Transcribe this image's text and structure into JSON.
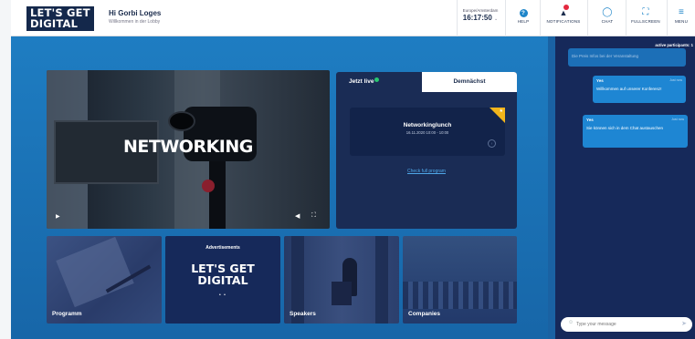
{
  "header": {
    "logo_line1": "LET'S GET",
    "logo_line2": "DIGITAL",
    "greeting_name": "Hi Gorbi Loges",
    "greeting_sub": "Willkommen in der Lobby",
    "timezone": "Europe/Amsterdam",
    "time": "16:17:50",
    "tools": {
      "help": "HELP",
      "notifications": "NOTIFICATIONS",
      "chat": "CHAT",
      "fullscreen": "FULLSCREEN",
      "menu": "MENU"
    }
  },
  "hero": {
    "title": "NETWORKING"
  },
  "schedule": {
    "tab_live": "Jetzt live",
    "tab_upcoming": "Demnächst",
    "session_name": "Networkinglunch",
    "session_time": "16.11.2020 10:00 - 10:00",
    "full_program_link": "Check full program"
  },
  "tiles": {
    "program": "Programm",
    "ads_title": "Advertisements",
    "ads_logo_line1": "LET'S GET",
    "ads_logo_line2": "DIGITAL",
    "ads_pager": "• •",
    "speakers": "Speakers",
    "companies": "Companies"
  },
  "chat": {
    "participants": "active participants: 1",
    "messages": [
      {
        "author": "",
        "time": "",
        "text": "Die Preis Infos bei der Veranstaltung"
      },
      {
        "author": "Yes",
        "time": "Just now",
        "text": "Willkommen auf unserer Konferenz!"
      },
      {
        "author": "Yes",
        "time": "Just now",
        "text": "Sie können sich in dem Chat austauschen"
      }
    ],
    "input_placeholder": "Type your message"
  }
}
